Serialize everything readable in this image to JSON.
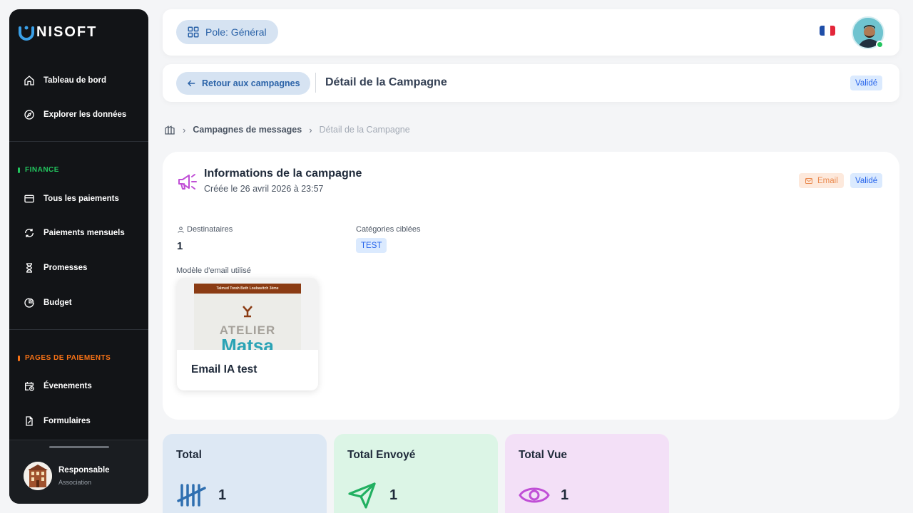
{
  "app": {
    "brand_initial": "U",
    "brand_rest": "NISOFT"
  },
  "sidebar": {
    "items_top": [
      {
        "label": "Tableau de bord",
        "icon": "home-icon"
      },
      {
        "label": "Explorer les données",
        "icon": "compass-icon"
      }
    ],
    "finance_label": "FINANCE",
    "finance_items": [
      {
        "label": "Tous les paiements",
        "icon": "credit-card-icon"
      },
      {
        "label": "Paiements mensuels",
        "icon": "refresh-icon"
      },
      {
        "label": "Promesses",
        "icon": "hourglass-icon"
      },
      {
        "label": "Budget",
        "icon": "pie-chart-icon"
      }
    ],
    "pages_label": "PAGES DE PAIEMENTS",
    "pages_items": [
      {
        "label": "Évenements",
        "icon": "calendar-clock-icon"
      },
      {
        "label": "Formulaires",
        "icon": "form-file-icon"
      }
    ],
    "user": {
      "name": "Responsable",
      "role": "Association"
    }
  },
  "topbar": {
    "pole_label": "Pole: Général",
    "language": "FR"
  },
  "subheader": {
    "back_label": "Retour aux campagnes",
    "title": "Détail de la Campagne",
    "status": "Validé"
  },
  "breadcrumb": {
    "link": "Campagnes de messages",
    "current": "Détail de la Campagne"
  },
  "campaign": {
    "title": "Informations de la campagne",
    "created": "Créée le 26 avril 2026 à 23:57",
    "channel": "Email",
    "status": "Validé",
    "recipients_label": "Destinataires",
    "recipients_value": "1",
    "categories_label": "Catégories ciblées",
    "categories": [
      "TEST"
    ],
    "template_label": "Modèle d'email utilisé",
    "template": {
      "name": "Email IA test",
      "thumb_header": "Talmud Torah Beth Loubavitch 3ème",
      "thumb_word1": "ATELIER",
      "thumb_word2": "Matsa"
    }
  },
  "stats": [
    {
      "title": "Total",
      "value": "1",
      "icon": "tally-icon",
      "bg": "#dde8f4",
      "color": "#2f6fb0"
    },
    {
      "title": "Total Envoyé",
      "value": "1",
      "icon": "send-icon",
      "bg": "#dcf5e6",
      "color": "#22b061"
    },
    {
      "title": "Total Vue",
      "value": "1",
      "icon": "eye-icon",
      "bg": "#f3e0f7",
      "color": "#c04fd6"
    }
  ],
  "colors": {
    "accent": "#2b63a8",
    "finance": "#22c55e",
    "pages": "#f97316"
  }
}
